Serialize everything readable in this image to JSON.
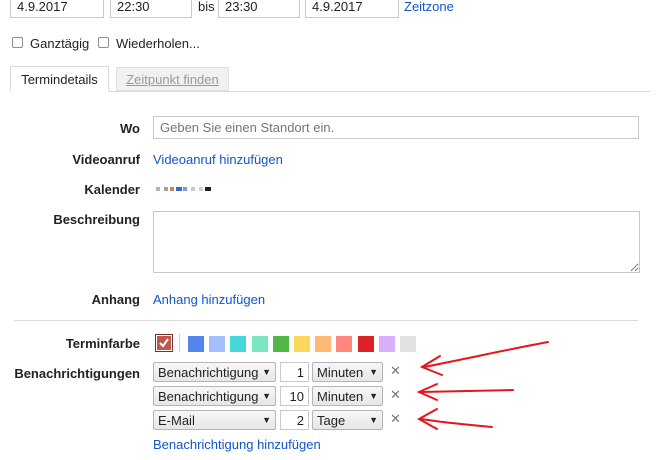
{
  "datetime": {
    "start_date": "4.9.2017",
    "start_time": "22:30",
    "to_label": "bis",
    "end_time": "23:30",
    "end_date": "4.9.2017",
    "timezone_link": "Zeitzone"
  },
  "options": {
    "all_day_label": "Ganztägig",
    "repeat_label": "Wiederholen..."
  },
  "tabs": [
    {
      "label": "Termindetails",
      "active": true
    },
    {
      "label": "Zeitpunkt finden",
      "active": false
    }
  ],
  "details": {
    "where_label": "Wo",
    "where_placeholder": "Geben Sie einen Standort ein.",
    "video_label": "Videoanruf",
    "video_link": "Videoanruf hinzufügen",
    "calendar_label": "Kalender",
    "description_label": "Beschreibung",
    "attachment_label": "Anhang",
    "attachment_link": "Anhang hinzufügen",
    "color_label": "Terminfarbe",
    "colors": {
      "selected": "#c0574d",
      "palette": [
        "#5484ed",
        "#a4bdfc",
        "#46d6db",
        "#7ae7bf",
        "#51b749",
        "#fbd75b",
        "#ffb878",
        "#ff887c",
        "#dc2127",
        "#dbadff",
        "#e1e1e1"
      ]
    },
    "notifications_label": "Benachrichtigungen",
    "notifications": [
      {
        "method": "Benachrichtigung",
        "value": "1",
        "unit": "Minuten"
      },
      {
        "method": "Benachrichtigung",
        "value": "10",
        "unit": "Minuten"
      },
      {
        "method": "E-Mail",
        "value": "2",
        "unit": "Tage"
      }
    ],
    "add_notification_link": "Benachrichtigung hinzufügen"
  },
  "annotation_color": "#e8141b"
}
